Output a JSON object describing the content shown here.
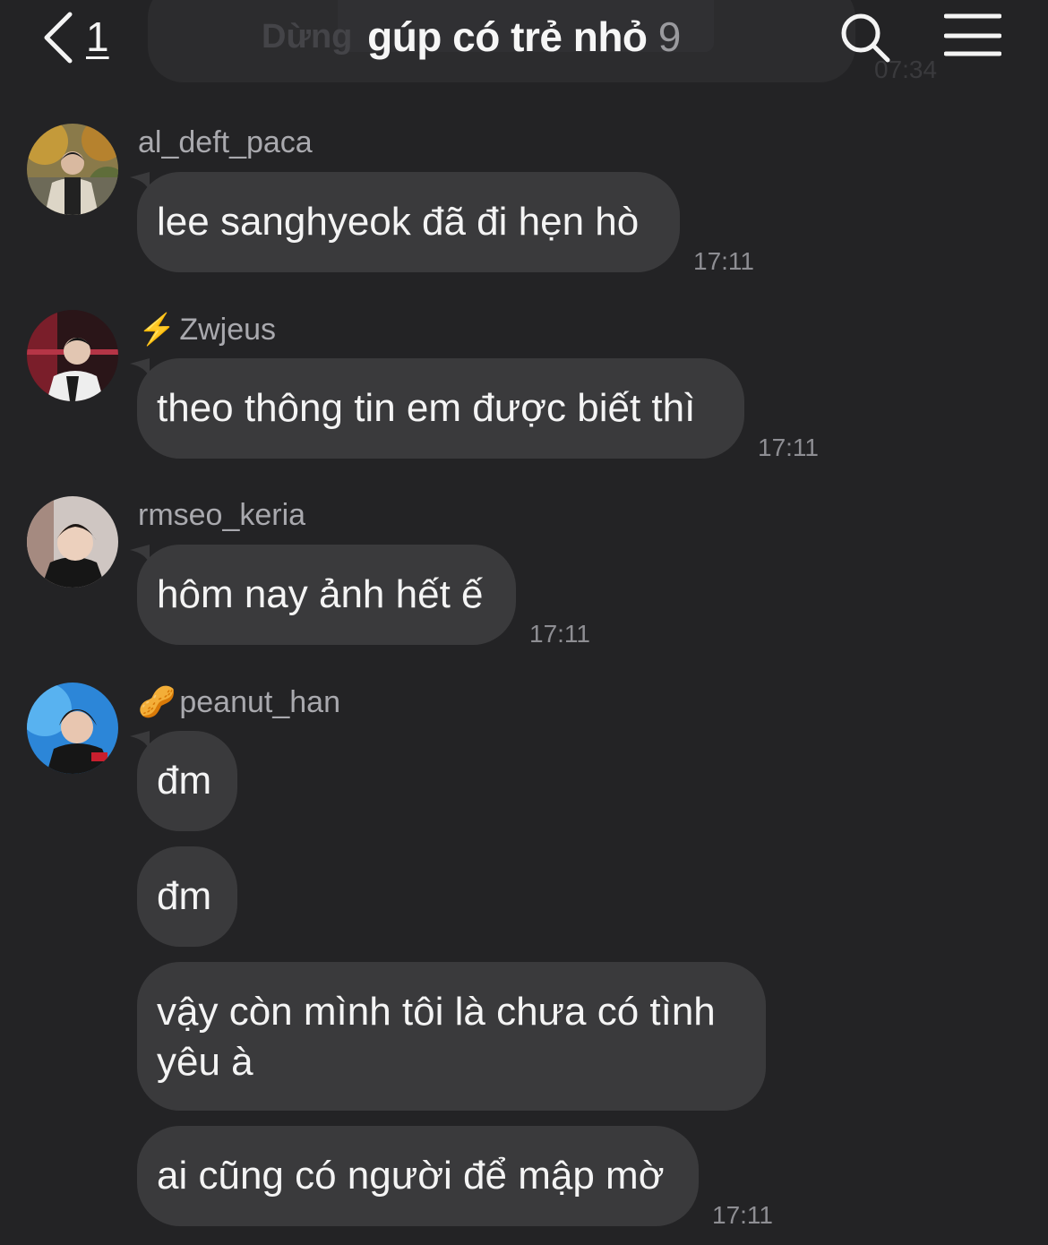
{
  "header": {
    "back_count": "1",
    "title": "gúp có trẻ nhỏ",
    "member_count": "9",
    "search_icon": "search-icon",
    "menu_icon": "menu-icon",
    "ghost_text": "Dừng",
    "ghost_time": "07:34"
  },
  "messages": [
    {
      "sender": "al_deft_paca",
      "badge": "",
      "text": "lee sanghyeok đã đi hẹn hò",
      "time": "17:11"
    },
    {
      "sender": "Zwjeus",
      "badge": "⚡",
      "text": "theo thông tin em được biết thì",
      "time": "17:11"
    },
    {
      "sender": "rmseo_keria",
      "badge": "",
      "text": "hôm nay ảnh hết ế",
      "time": "17:11"
    },
    {
      "sender": "peanut_han",
      "badge": "🥜",
      "texts": [
        "đm",
        "đm",
        "vậy còn mình tôi là chưa có tình yêu à",
        "ai cũng có người để mập mờ"
      ],
      "time": "17:11"
    }
  ],
  "colors": {
    "background": "#232325",
    "bubble": "#3a3a3c",
    "sender": "#a9a9ae",
    "time": "#8e8e93"
  }
}
